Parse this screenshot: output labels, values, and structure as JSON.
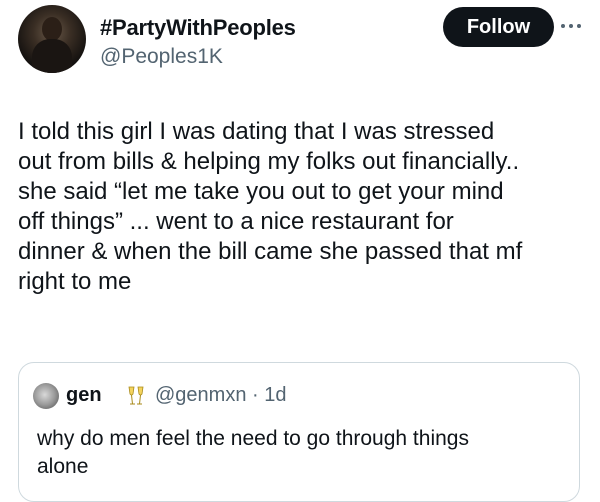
{
  "tweet": {
    "display_name": "#PartyWithPeoples",
    "handle": "@Peoples1K",
    "follow_label": "Follow",
    "text_lines": [
      "I told this girl I was dating that I was stressed",
      "out from bills & helping my folks out financially..",
      "she said “let me take you out to get your mind",
      "off things” ... went to a nice restaurant for",
      "dinner & when the bill came she passed that mf",
      "right to me"
    ]
  },
  "quote": {
    "display_name": "gen",
    "handle_time": "@genmxn · 1d",
    "text_lines": [
      "why do men feel the need to go through things",
      "alone"
    ]
  },
  "icons": {
    "more": "more-horizontal-icon",
    "emoji": "champagne-toast-icon"
  }
}
